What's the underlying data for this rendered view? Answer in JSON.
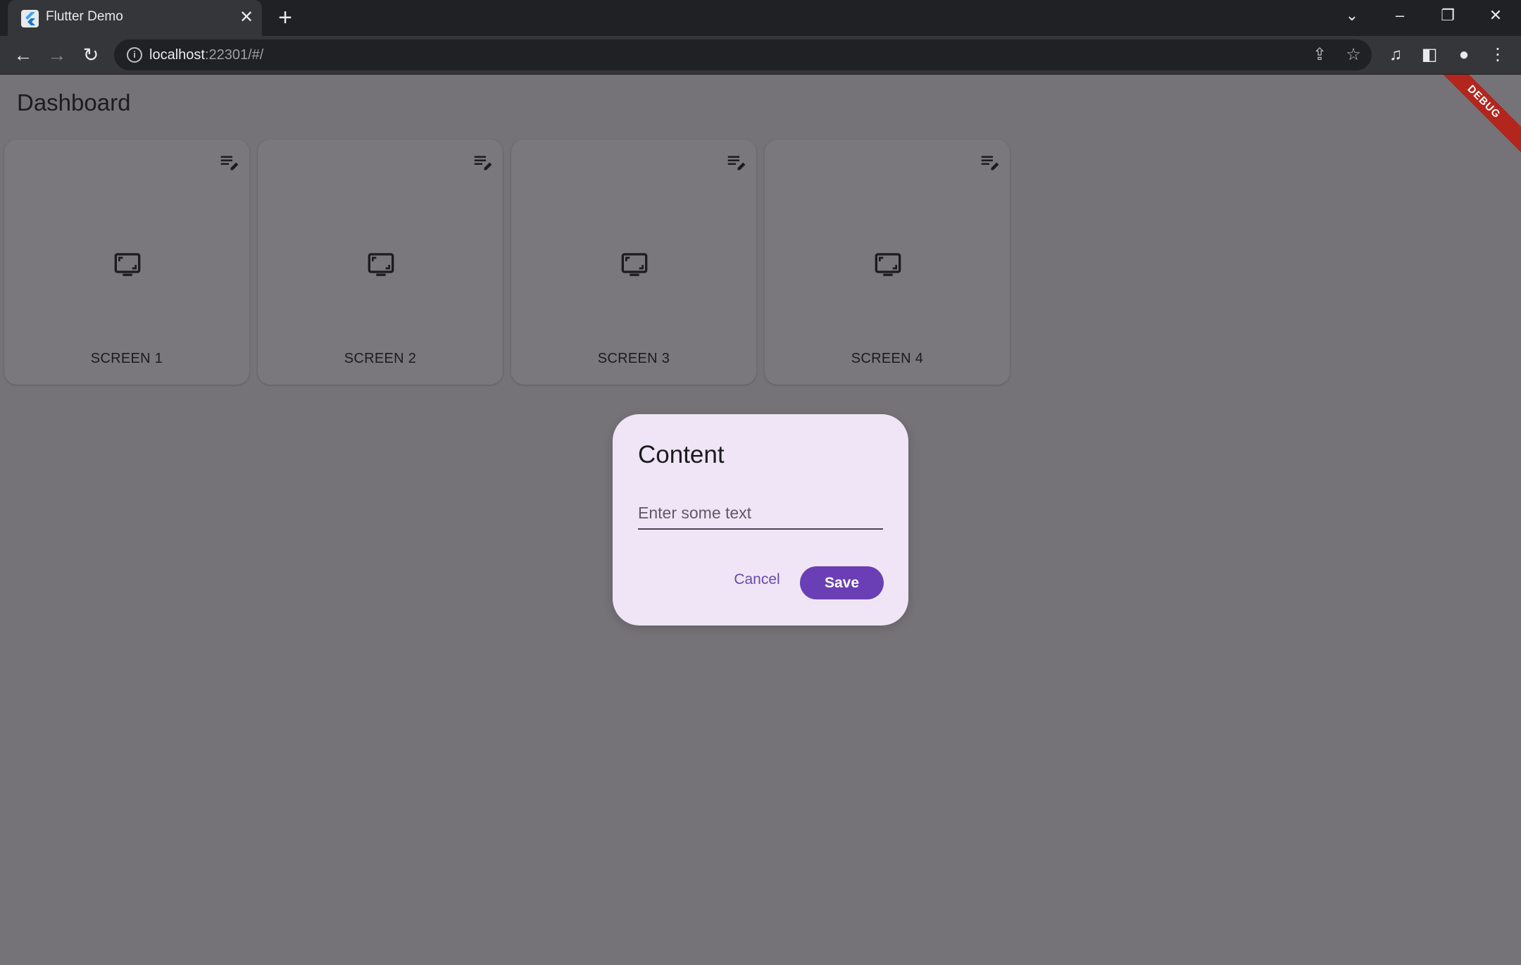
{
  "browser": {
    "tab_title": "Flutter Demo",
    "url_host": "localhost",
    "url_rest": ":22301/#/"
  },
  "app": {
    "title": "Dashboard",
    "debug_banner": "DEBUG",
    "cards": [
      {
        "label": "SCREEN 1"
      },
      {
        "label": "SCREEN 2"
      },
      {
        "label": "SCREEN 3"
      },
      {
        "label": "SCREEN 4"
      }
    ]
  },
  "dialog": {
    "title": "Content",
    "input_placeholder": "Enter some text",
    "input_value": "",
    "cancel_label": "Cancel",
    "save_label": "Save"
  },
  "colors": {
    "scrim": "#757378",
    "dialog_bg": "#f0e5f6",
    "primary": "#6a3fb5",
    "debug": "#b3261e"
  }
}
